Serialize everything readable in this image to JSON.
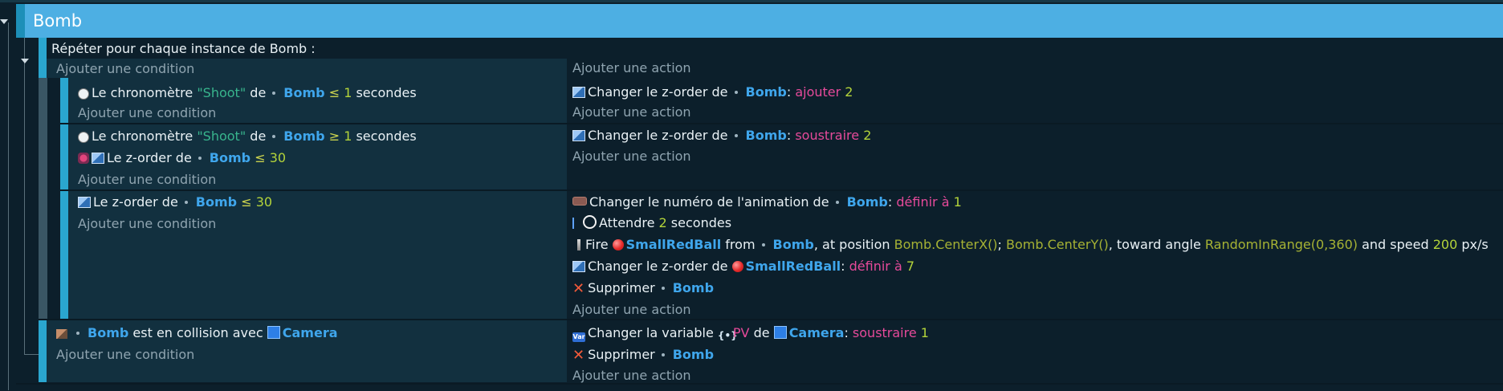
{
  "group": {
    "title": "Bomb"
  },
  "labels": {
    "add_condition": "Ajouter une condition",
    "add_action": "Ajouter une action"
  },
  "repeat": {
    "text": "Répéter pour chaque instance de Bomb :"
  },
  "event1": {
    "cond1": {
      "part1": "Le chronomètre",
      "timer": "\"Shoot\"",
      "de": "de",
      "object": "Bomb",
      "op": "≤",
      "value": "1",
      "unit": "secondes"
    },
    "act1": {
      "part1": "Changer le z-order de",
      "object": "Bomb",
      "colon": ":",
      "verb": "ajouter",
      "value": "2"
    }
  },
  "event2": {
    "cond1": {
      "part1": "Le chronomètre",
      "timer": "\"Shoot\"",
      "de": "de",
      "object": "Bomb",
      "op": "≥",
      "value": "1",
      "unit": "secondes"
    },
    "cond2": {
      "part1": "Le z-order de",
      "object": "Bomb",
      "op": "≤",
      "value": "30"
    },
    "act1": {
      "part1": "Changer le z-order de",
      "object": "Bomb",
      "colon": ":",
      "verb": "soustraire",
      "value": "2"
    }
  },
  "event3": {
    "cond1": {
      "part1": "Le z-order de",
      "object": "Bomb",
      "op": "≤",
      "value": "30"
    },
    "act_anim": {
      "part1": "Changer le numéro de l'animation de",
      "object": "Bomb",
      "colon": ":",
      "verb": "définir à",
      "value": "1"
    },
    "act_wait": {
      "part1": "Attendre",
      "value": "2",
      "unit": "secondes"
    },
    "act_fire": {
      "part1": "Fire",
      "bullet": "SmallRedBall",
      "from": "from",
      "object": "Bomb",
      "at": ", at position",
      "x": "Bomb.CenterX()",
      "sep": ";",
      "y": "Bomb.CenterY()",
      "toward": ", toward angle",
      "angle": "RandomInRange(0,360)",
      "speed_label": "and speed",
      "speed": "200",
      "unit": "px/s"
    },
    "act_z": {
      "part1": "Changer le z-order de",
      "object": "SmallRedBall",
      "colon": ":",
      "verb": "définir à",
      "value": "7"
    },
    "act_del": {
      "part1": "Supprimer",
      "object": "Bomb"
    }
  },
  "event4": {
    "cond1": {
      "object": "Bomb",
      "part1": "est en collision avec",
      "target": "Camera"
    },
    "act_var": {
      "part1": "Changer la variable",
      "var": "PV",
      "de": "de",
      "object": "Camera",
      "colon": ":",
      "verb": "soustraire",
      "value": "1"
    },
    "act_del": {
      "part1": "Supprimer",
      "object": "Bomb"
    }
  },
  "colors": {
    "background": "#0c1f2b",
    "group_header": "#4dafe3",
    "condition_panel": "#12303f",
    "object": "#3fa6ec",
    "string": "#38b58d",
    "number": "#b3d33a",
    "keyword": "#e64a9a"
  }
}
